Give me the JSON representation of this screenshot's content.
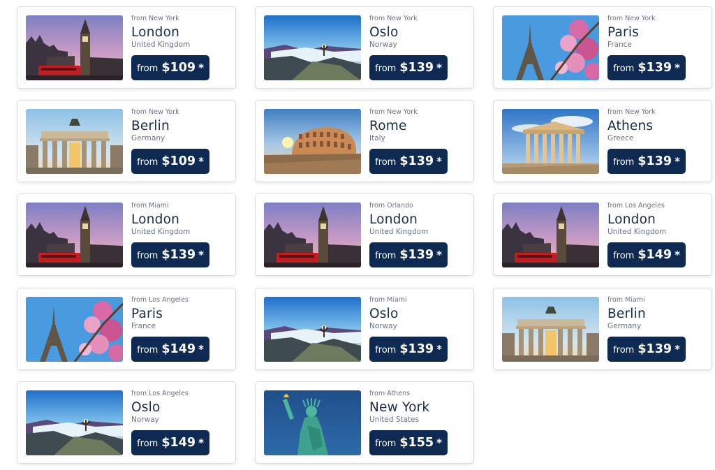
{
  "cards": [
    {
      "origin": "from New York",
      "city": "London",
      "country": "United Kingdom",
      "from_label": "from",
      "price": "$109",
      "star": "*",
      "image": "london"
    },
    {
      "origin": "from New York",
      "city": "Oslo",
      "country": "Norway",
      "from_label": "from",
      "price": "$139",
      "star": "*",
      "image": "oslo"
    },
    {
      "origin": "from New York",
      "city": "Paris",
      "country": "France",
      "from_label": "from",
      "price": "$139",
      "star": "*",
      "image": "paris"
    },
    {
      "origin": "from New York",
      "city": "Berlin",
      "country": "Germany",
      "from_label": "from",
      "price": "$109",
      "star": "*",
      "image": "berlin"
    },
    {
      "origin": "from New York",
      "city": "Rome",
      "country": "Italy",
      "from_label": "from",
      "price": "$139",
      "star": "*",
      "image": "rome"
    },
    {
      "origin": "from New York",
      "city": "Athens",
      "country": "Greece",
      "from_label": "from",
      "price": "$139",
      "star": "*",
      "image": "athens"
    },
    {
      "origin": "from Miami",
      "city": "London",
      "country": "United Kingdom",
      "from_label": "from",
      "price": "$139",
      "star": "*",
      "image": "london"
    },
    {
      "origin": "from Orlando",
      "city": "London",
      "country": "United Kingdom",
      "from_label": "from",
      "price": "$139",
      "star": "*",
      "image": "london"
    },
    {
      "origin": "from Los Angeles",
      "city": "London",
      "country": "United Kingdom",
      "from_label": "from",
      "price": "$149",
      "star": "*",
      "image": "london"
    },
    {
      "origin": "from Los Angeles",
      "city": "Paris",
      "country": "France",
      "from_label": "from",
      "price": "$149",
      "star": "*",
      "image": "paris"
    },
    {
      "origin": "from Miami",
      "city": "Oslo",
      "country": "Norway",
      "from_label": "from",
      "price": "$139",
      "star": "*",
      "image": "oslo"
    },
    {
      "origin": "from Miami",
      "city": "Berlin",
      "country": "Germany",
      "from_label": "from",
      "price": "$139",
      "star": "*",
      "image": "berlin"
    },
    {
      "origin": "from Los Angeles",
      "city": "Oslo",
      "country": "Norway",
      "from_label": "from",
      "price": "$149",
      "star": "*",
      "image": "oslo"
    },
    {
      "origin": "from Athens",
      "city": "New York",
      "country": "United States",
      "from_label": "from",
      "price": "$155",
      "star": "*",
      "image": "newyork"
    }
  ],
  "colors": {
    "button": "#0f2a52",
    "city": "#1a2a4a",
    "muted": "#6a7383",
    "border": "#d9dde3"
  }
}
